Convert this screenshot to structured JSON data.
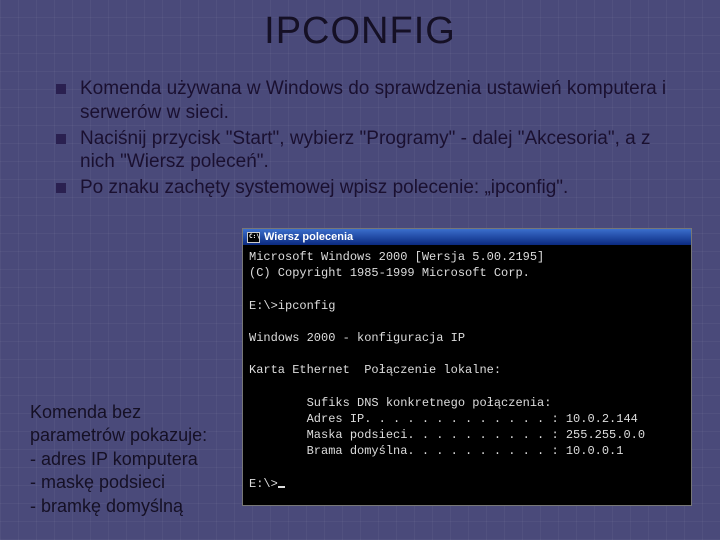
{
  "title": "IPCONFIG",
  "bullets": [
    "Komenda używana w Windows do sprawdzenia ustawień komputera i serwerów w sieci.",
    "Naciśnij przycisk \"Start\", wybierz \"Programy\" - dalej \"Akcesoria\", a z nich \"Wiersz poleceń\".",
    "Po znaku zachęty systemowej wpisz polecenie: „ipconfig\"."
  ],
  "caption": "Komenda bez parametrów pokazuje:\n- adres IP komputera\n- maskę podsieci\n- bramkę domyślną",
  "cmd": {
    "title": "Wiersz polecenia",
    "lines": [
      "Microsoft Windows 2000 [Wersja 5.00.2195]",
      "(C) Copyright 1985-1999 Microsoft Corp.",
      "",
      "E:\\>ipconfig",
      "",
      "Windows 2000 - konfiguracja IP",
      "",
      "Karta Ethernet  Połączenie lokalne:",
      "",
      "        Sufiks DNS konkretnego połączenia:",
      "        Adres IP. . . . . . . . . . . . . : 10.0.2.144",
      "        Maska podsieci. . . . . . . . . . : 255.255.0.0",
      "        Brama domyślna. . . . . . . . . . : 10.0.0.1",
      "",
      "E:\\>"
    ]
  }
}
